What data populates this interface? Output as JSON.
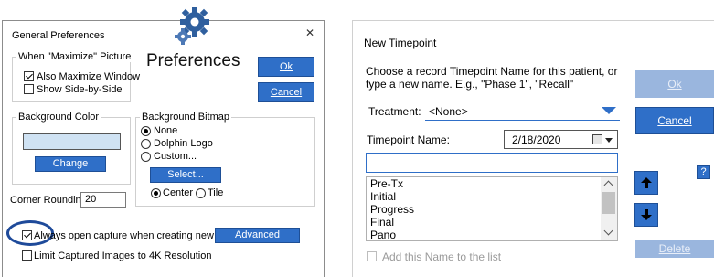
{
  "general_prefs": {
    "title": "General Preferences",
    "close_glyph": "✕",
    "banner": "Preferences",
    "ok_label": "Ok",
    "cancel_label": "Cancel",
    "maximize_group": {
      "legend": "When \"Maximize\" Picture",
      "also_maximize": "Also Maximize Window",
      "side_by_side": "Show Side-by-Side"
    },
    "bg_color_group": {
      "legend": "Background Color",
      "swatch_color": "#cfe2f3",
      "change_label": "Change Color..."
    },
    "bg_bitmap_group": {
      "legend": "Background Bitmap",
      "options": [
        "None",
        "Dolphin Logo",
        "Custom..."
      ],
      "select_label": "Select...",
      "center_label": "Center",
      "tile_label": "Tile"
    },
    "corner_rounding_label": "Corner Rounding:",
    "corner_rounding_value": "20",
    "always_open_capture": "Always open capture when creating new patient",
    "advanced_label": "Advanced Settings...",
    "limit_4k": "Limit Captured Images to 4K Resolution"
  },
  "new_timepoint": {
    "title": "New Timepoint",
    "instruction_line1": "Choose a record Timepoint Name for this patient, or",
    "instruction_line2": "type a new name.  E.g., \"Phase 1\", \"Recall\"",
    "ok_label": "Ok",
    "cancel_label": "Cancel",
    "treatment_label": "Treatment:",
    "treatment_value": "<None>",
    "timepoint_name_label": "Timepoint Name:",
    "date_value": "2/18/2020",
    "name_input_value": "",
    "list_items": [
      "Pre-Tx",
      "Initial",
      "Progress",
      "Final",
      "Pano"
    ],
    "help_label": "?",
    "add_to_list_label": "Add this Name to the list",
    "delete_label": "Delete"
  },
  "colors": {
    "accent_blue": "#2f6fc8",
    "highlight_ring": "#1e4a9a"
  }
}
